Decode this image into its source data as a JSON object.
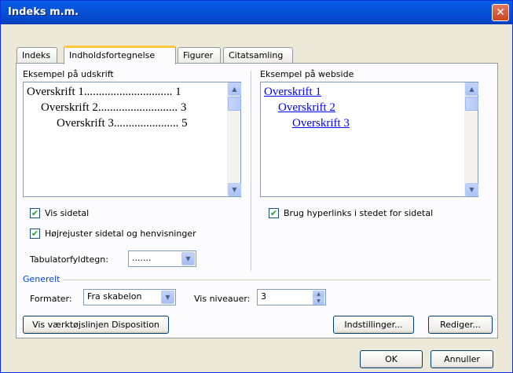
{
  "window": {
    "title": "Indeks m.m.",
    "close_symbol": "✕"
  },
  "tabs": [
    {
      "label": "Indeks",
      "active": false
    },
    {
      "label": "Indholdsfortegnelse",
      "active": true
    },
    {
      "label": "Figurer",
      "active": false
    },
    {
      "label": "Citatsamling",
      "active": false
    }
  ],
  "print_preview": {
    "label": "Eksempel på udskrift",
    "lines": [
      "Overskrift 1.............................. 1",
      "Overskrift 2........................... 3",
      "Overskrift 3...................... 5"
    ]
  },
  "web_preview": {
    "label": "Eksempel på webside",
    "lines": [
      "Overskrift 1",
      "Overskrift 2",
      "Overskrift 3"
    ]
  },
  "options": {
    "show_page_numbers": {
      "label": "Vis sidetal",
      "checked": true
    },
    "right_align": {
      "label": "Højrejuster sidetal og henvisninger",
      "checked": true
    },
    "use_hyperlinks": {
      "label": "Brug hyperlinks i stedet for sidetal",
      "checked": true
    },
    "tab_leader": {
      "label": "Tabulatorfyldtegn:",
      "value": "......."
    }
  },
  "general": {
    "title": "Generelt",
    "formats": {
      "label": "Formater:",
      "value": "Fra skabelon"
    },
    "levels": {
      "label": "Vis niveauer:",
      "value": "3"
    }
  },
  "buttons": {
    "outline_toolbar": "Vis værktøjslinjen Disposition",
    "settings": "Indstillinger...",
    "edit": "Rediger...",
    "ok": "OK",
    "cancel": "Annuller"
  },
  "icons": {
    "scroll_up": "▲",
    "scroll_down": "▼",
    "check": "✔"
  },
  "colors": {
    "title_bar": "#0a5ee8",
    "link": "#0000ee",
    "group_title": "#0046d5",
    "close": "#c8451e"
  }
}
